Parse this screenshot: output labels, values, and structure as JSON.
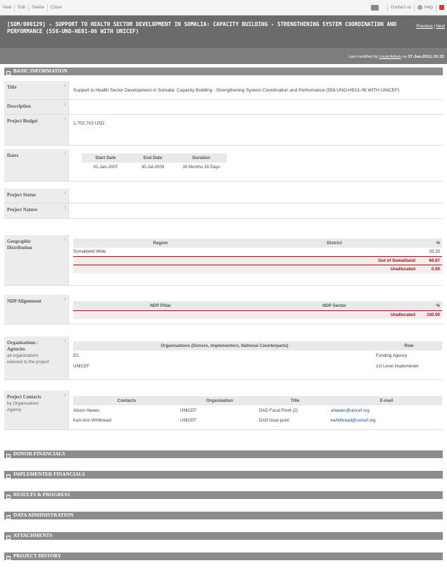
{
  "toolbar": {
    "left": [
      "New",
      "Edit",
      "Delete",
      "Close"
    ],
    "contact": "Contact us",
    "help": "Help"
  },
  "header": {
    "title": "[SOM/000129] - SUPPORT TO HEALTH SECTOR DEVELOPMENT IN SOMALIA: CAPACITY BUILDING - STRENGTHENING SYSTEM COORDINATION AND PERFORMANCE (558-UNO-HE01-06 WITH UNICEF)",
    "previous": "Previous",
    "next": "Next"
  },
  "modified": {
    "prefix": "Last modified by",
    "user": "Local Admin",
    "on": "on",
    "date": "27-Jan-2012, 01:22"
  },
  "sections": {
    "basic": "BASIC INFORMATION",
    "donor": "DONOR FINANCIALS",
    "implementer": "IMPLEMENTER FINANCIALS",
    "results": "RESULTS & PROGRESS",
    "data_admin": "DATA ADMINISTRATION",
    "attachments": "ATTACHMENTS",
    "history": "PROJECT HISTORY"
  },
  "labels": {
    "title": "Title",
    "description": "Description",
    "budget": "Project Budget",
    "dates": "Dates",
    "status": "Project Status",
    "nature": "Project Nature",
    "geo1": "Geographic",
    "geo2": "Distribution",
    "ndp": "NDP Alignement",
    "org1": "Organisations /",
    "org2": "Agencies",
    "org_sub1": "all organisations",
    "org_sub2": "relevant to the project",
    "contacts": "Project Contacts",
    "contacts_sub1": "by Organisation/",
    "contacts_sub2": "Agency",
    "info": "i"
  },
  "values": {
    "title": "Support to Health Sector Development in Somalia: Capacity Building - Strengthening System Coordination and Performance (558-UNO-HE01-06 WITH UNICEF)",
    "budget": "2,702,703 USD"
  },
  "dates": {
    "headers": [
      "Start Date",
      "End Date",
      "Duration"
    ],
    "row": [
      "01-Jan-2007",
      "30-Jul-2009",
      "30 Months 29 Days"
    ]
  },
  "geo": {
    "headers": [
      "Region",
      "District",
      "%"
    ],
    "row": [
      "Somaliland Wide",
      "",
      "33.33"
    ],
    "out_label": "Out of Somaliland",
    "out_value": "66.67",
    "unalloc_label": "Unallocated",
    "unalloc_value": "0.00"
  },
  "ndp": {
    "headers": [
      "NDP Pillar",
      "NDP Sector",
      "%"
    ],
    "unalloc_label": "Unallocated",
    "unalloc_value": "100.00"
  },
  "orgs": {
    "headers": [
      "Organisations (Donors, Implementers, National Counterparts)",
      "Role"
    ],
    "rows": [
      [
        "EC",
        "Funding Agency"
      ],
      [
        "UNICEF",
        "1st Level Implementer"
      ]
    ]
  },
  "contacts": {
    "headers": [
      "Contacts",
      "Organisation",
      "Title",
      "E-mail"
    ],
    "rows": [
      [
        "Alison Hawes",
        "UNICEF",
        "DAD Focal Point (2)",
        "ahawes@unicef.org"
      ],
      [
        "Kari-Ann Whitbread",
        "UNICEF",
        "DAD focal point",
        "kwhitbread@unicef.org"
      ]
    ]
  },
  "colors": {
    "header_bg": "#6b6b6b",
    "section_bg": "#8c8c8c",
    "accent_red": "#a01020",
    "link": "#1a4b9c"
  }
}
